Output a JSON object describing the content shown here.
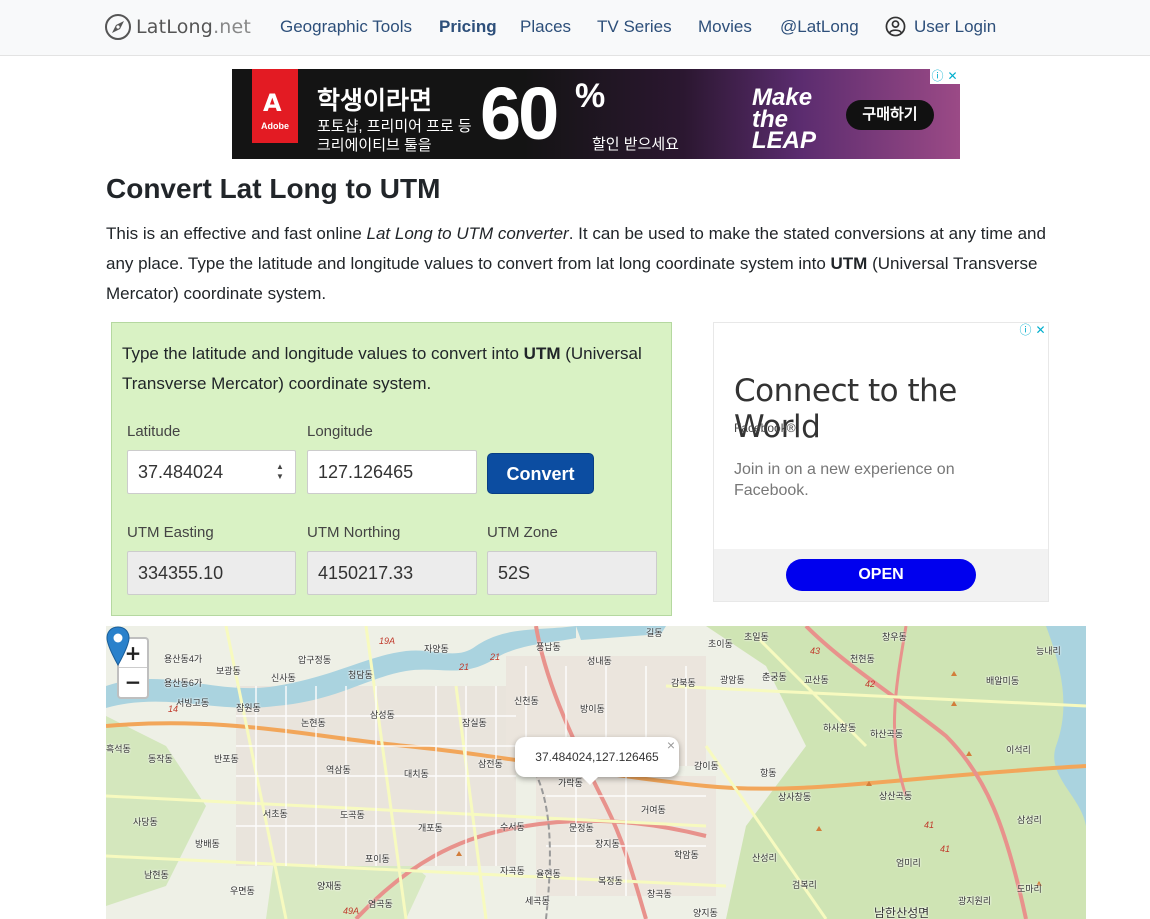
{
  "nav": {
    "brand_main": "LatLong",
    "brand_tld": ".net",
    "links": [
      {
        "label": "Geographic Tools"
      },
      {
        "label": "Pricing"
      },
      {
        "label": "Places"
      },
      {
        "label": "TV Series"
      },
      {
        "label": "Movies"
      },
      {
        "label": "@LatLong"
      },
      {
        "label": "User Login"
      }
    ]
  },
  "banner_ad": {
    "logo_text": "Adobe",
    "headline": "학생이라면",
    "line1": "포토샵, 프리미어 프로 등",
    "line2": "크리에이티브 툴을",
    "big_number": "60",
    "percent": "%",
    "sale_text": "할인 받으세요",
    "make_text": "Make the LEAP",
    "buy_label": "구매하기"
  },
  "page": {
    "title": "Convert Lat Long to UTM",
    "intro_part1": "This is an effective and fast online ",
    "intro_em": "Lat Long to UTM converter",
    "intro_part2": ". It can be used to make the stated conversions at any time and any place. Type the latitude and longitude values to convert from lat long coordinate system into ",
    "intro_bold": "UTM",
    "intro_part3": " (Universal Transverse Mercator) coordinate system."
  },
  "form": {
    "intro_part1": "Type the latitude and longitude values to convert into ",
    "intro_bold": "UTM",
    "intro_part2": " (Universal Transverse Mercator) coordinate system.",
    "latitude_label": "Latitude",
    "latitude_value": "37.484024",
    "longitude_label": "Longitude",
    "longitude_value": "127.126465",
    "convert_label": "Convert",
    "easting_label": "UTM Easting",
    "easting_value": "334355.10",
    "northing_label": "UTM Northing",
    "northing_value": "4150217.33",
    "zone_label": "UTM Zone",
    "zone_value": "52S"
  },
  "side_ad": {
    "title": "Connect to the World",
    "brand": "Facebook®",
    "body": "Join in on a new experience on Facebook.",
    "open_label": "OPEN"
  },
  "map": {
    "zoom_in": "+",
    "zoom_out": "−",
    "popup_text": "37.484024,127.126465",
    "popup_close": "×",
    "labels": [
      "용산동4가",
      "보광동",
      "용산동6가",
      "서빙고동",
      "압구정동",
      "신사동",
      "청담동",
      "자양동",
      "풍납동",
      "성내동",
      "길동",
      "초이동",
      "초일동",
      "창우동",
      "능내리",
      "잠원동",
      "논현동",
      "삼성동",
      "잠실동",
      "신천동",
      "방이동",
      "감북동",
      "광암동",
      "춘궁동",
      "교산동",
      "천현동",
      "배알미동",
      "흑석동",
      "동작동",
      "반포동",
      "역삼동",
      "대치동",
      "삼전동",
      "가락동",
      "하사창동",
      "하산곡동",
      "이석리",
      "사당동",
      "서초동",
      "도곡동",
      "개포동",
      "수서동",
      "문정동",
      "장지동",
      "거여동",
      "감이동",
      "항동",
      "상사창동",
      "상산곡동",
      "삼성리",
      "방배동",
      "포이동",
      "자곡동",
      "율현동",
      "복정동",
      "학암동",
      "산성리",
      "엄미리",
      "남현동",
      "우면동",
      "양재동",
      "염곡동",
      "세곡동",
      "창곡동",
      "양지동",
      "검복리",
      "남한산성면",
      "광지원리",
      "도마리"
    ],
    "routes": [
      "19A",
      "21",
      "21",
      "43",
      "42",
      "41",
      "41",
      "14",
      "49A"
    ]
  }
}
